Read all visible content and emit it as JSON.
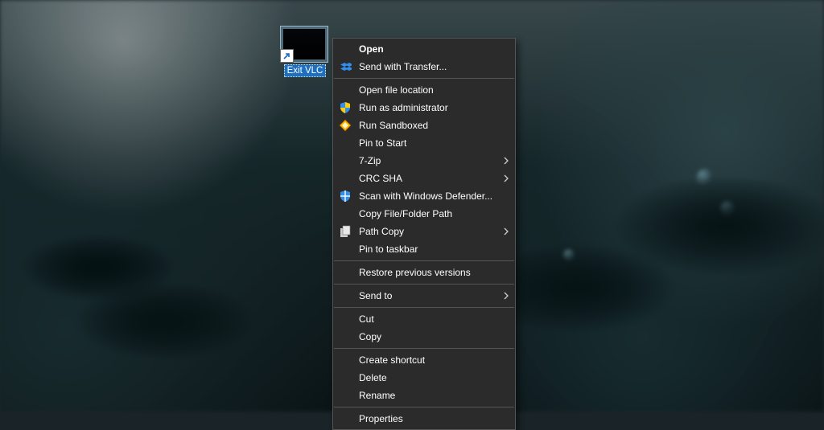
{
  "shortcut": {
    "label": "Exit VLC"
  },
  "context_menu": {
    "items": [
      {
        "label": "Open",
        "bold": true
      },
      {
        "label": "Send with Transfer...",
        "icon": "dropbox"
      },
      {
        "sep": true
      },
      {
        "label": "Open file location"
      },
      {
        "label": "Run as administrator",
        "icon": "uac-shield"
      },
      {
        "label": "Run Sandboxed",
        "icon": "sandbox-diamond"
      },
      {
        "label": "Pin to Start"
      },
      {
        "label": "7-Zip",
        "submenu": true
      },
      {
        "label": "CRC SHA",
        "submenu": true
      },
      {
        "label": "Scan with Windows Defender...",
        "icon": "defender-shield"
      },
      {
        "label": "Copy File/Folder Path"
      },
      {
        "label": "Path Copy",
        "icon": "copy",
        "submenu": true
      },
      {
        "label": "Pin to taskbar"
      },
      {
        "sep": true
      },
      {
        "label": "Restore previous versions"
      },
      {
        "sep": true
      },
      {
        "label": "Send to",
        "submenu": true
      },
      {
        "sep": true
      },
      {
        "label": "Cut"
      },
      {
        "label": "Copy"
      },
      {
        "sep": true
      },
      {
        "label": "Create shortcut"
      },
      {
        "label": "Delete"
      },
      {
        "label": "Rename"
      },
      {
        "sep": true
      },
      {
        "label": "Properties"
      }
    ]
  }
}
